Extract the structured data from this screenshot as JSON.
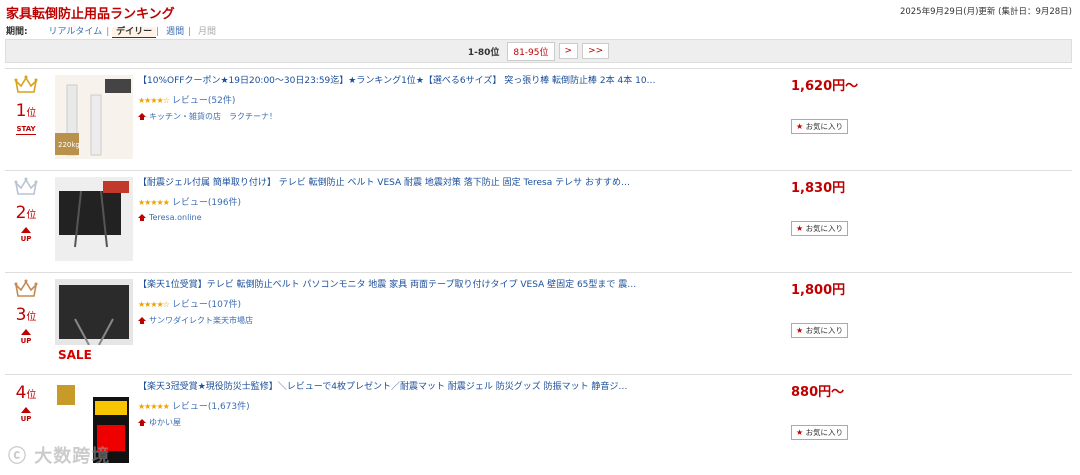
{
  "page": {
    "title": "家具転倒防止用品ランキング",
    "updated": "2025年9月29日(月)更新 (集計日：9月28日)"
  },
  "period": {
    "label": "期間:",
    "options": [
      "リアルタイム",
      "デイリー",
      "週間",
      "月間"
    ],
    "selected": "デイリー"
  },
  "pager": {
    "current": "1-80位",
    "next_range": "81-95位",
    "next": ">",
    "last": ">>"
  },
  "items": [
    {
      "rank": "1",
      "rank_suffix": "位",
      "status": "STAY",
      "crown_color": "#d8a21c",
      "title": "【10%OFFクーポン★19日20:00〜30日23:59迄】★ランキング1位★【選べる6サイズ】 突っ張り棒 転倒防止棒 2本 4本 10…",
      "stars": "★★★★☆",
      "reviews": "レビュー(52件)",
      "shop": "キッチン・雑貨の店　ラクチーナ！",
      "price": "1,620円〜",
      "fav": "お気に入り"
    },
    {
      "rank": "2",
      "rank_suffix": "位",
      "status": "UP",
      "crown_color": "#b8c4d4",
      "title": "【耐震ジェル付属 簡単取り付け】 テレビ 転倒防止 ベルト VESA 耐震 地震対策 落下防止 固定 Teresa テレサ おすすめ…",
      "stars": "★★★★★",
      "reviews": "レビュー(196件)",
      "shop": "Teresa.online",
      "price": "1,830円",
      "fav": "お気に入り"
    },
    {
      "rank": "3",
      "rank_suffix": "位",
      "status": "UP",
      "crown_color": "#c48a52",
      "title": "【楽天1位受賞】テレビ 転倒防止ベルト パソコンモニタ 地震 家具 両面テープ取り付けタイプ VESA 壁固定 65型まで 震…",
      "stars": "★★★★☆",
      "reviews": "レビュー(107件)",
      "shop": "サンワダイレクト楽天市場店",
      "price": "1,800円",
      "fav": "お気に入り",
      "sale": "SALE"
    },
    {
      "rank": "4",
      "rank_suffix": "位",
      "status": "UP",
      "crown_color": "",
      "title": "【楽天3冠受賞★現役防災士監修】＼レビューで4枚プレゼント／耐震マット 耐震ジェル 防災グッズ 防振マット 静音ジ…",
      "stars": "★★★★★",
      "reviews": "レビュー(1,673件)",
      "shop": "ゆかい屋",
      "price": "880円〜",
      "fav": "お気に入り"
    }
  ]
}
